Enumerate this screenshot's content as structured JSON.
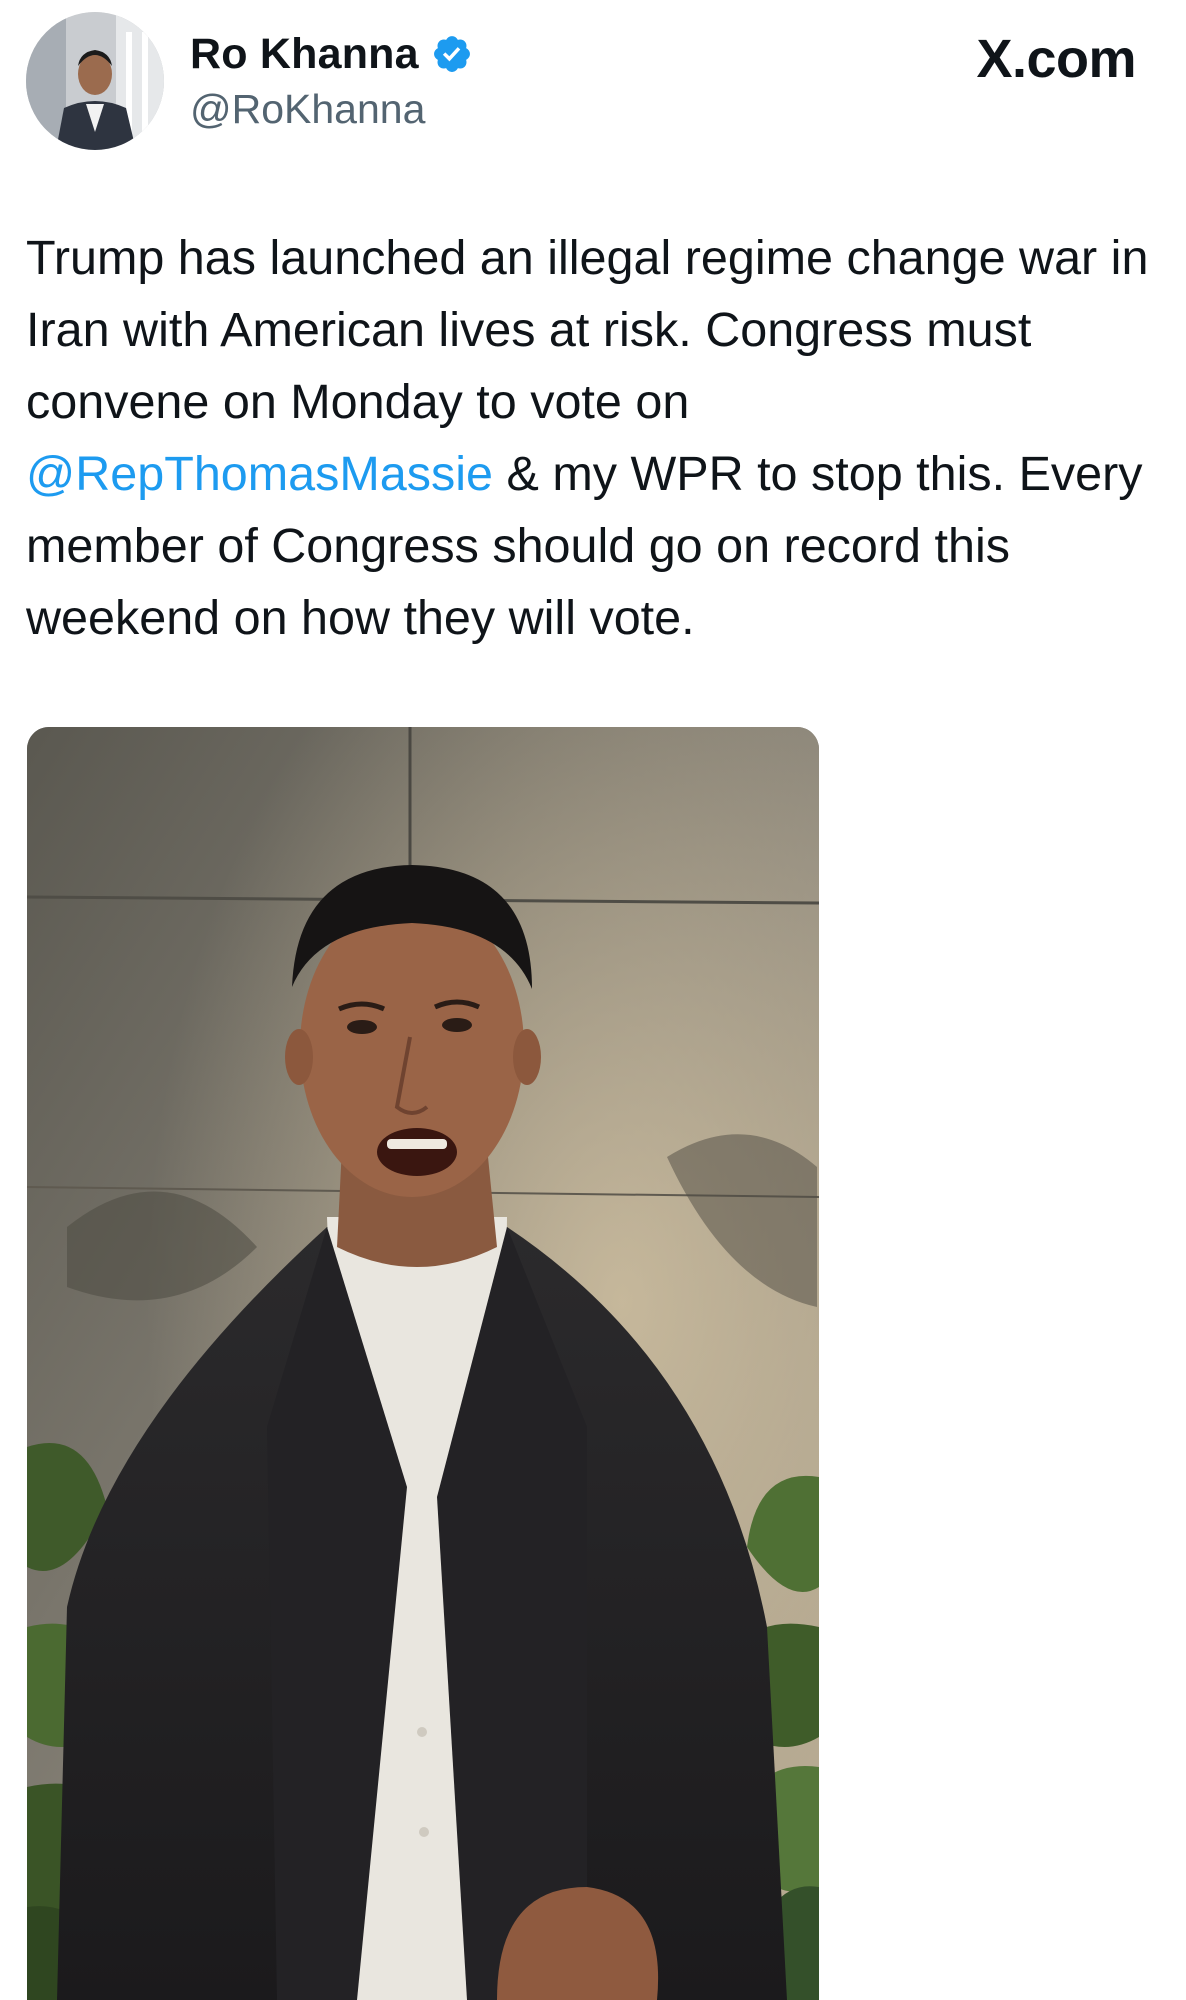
{
  "author": {
    "display_name": "Ro Khanna",
    "handle": "@RoKhanna",
    "verified": true,
    "verified_badge_color": "#1d9bf0"
  },
  "site": {
    "label": "X.com"
  },
  "tweet": {
    "text_part1": "Trump has launched an illegal regime change war in Iran with American lives at risk. Congress must convene on Monday to vote on ",
    "mention": "@RepThomasMassie",
    "text_part2": " & my WPR to stop this. Every member of Congress should go on record this weekend on how they will vote.",
    "mention_color": "#1d9bf0"
  },
  "media": {
    "type": "video",
    "icon": "video-thumbnail"
  }
}
